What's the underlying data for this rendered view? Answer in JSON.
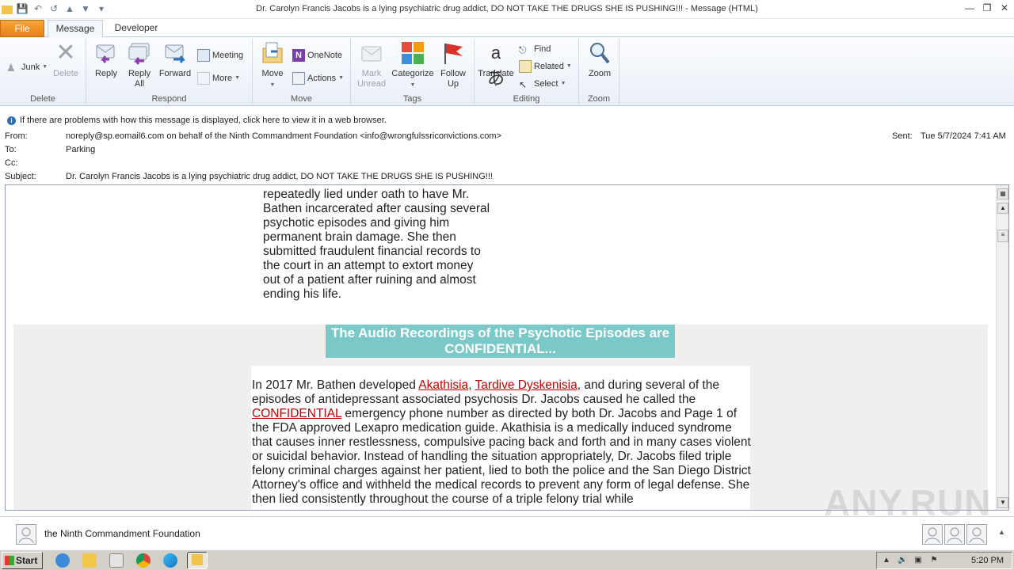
{
  "window": {
    "title": "Dr. Carolyn Francis Jacobs is a lying psychiatric drug addict, DO NOT TAKE THE DRUGS SHE IS PUSHING!!! - Message (HTML)"
  },
  "tabs": {
    "file": "File",
    "message": "Message",
    "developer": "Developer"
  },
  "ribbon": {
    "delete_group": {
      "label": "Delete",
      "junk": "Junk",
      "delete": "Delete"
    },
    "respond_group": {
      "label": "Respond",
      "reply": "Reply",
      "reply_all": "Reply All",
      "forward": "Forward",
      "meeting": "Meeting",
      "more": "More"
    },
    "move_group": {
      "label": "Move",
      "move": "Move",
      "onenote": "OneNote",
      "actions": "Actions"
    },
    "tags_group": {
      "label": "Tags",
      "mark_unread": "Mark Unread",
      "categorize": "Categorize",
      "follow_up": "Follow Up"
    },
    "editing_group": {
      "label": "Editing",
      "translate": "Translate",
      "find": "Find",
      "related": "Related",
      "select": "Select"
    },
    "zoom_group": {
      "label": "Zoom",
      "zoom": "Zoom"
    }
  },
  "infobar": {
    "text": "If there are problems with how this message is displayed, click here to view it in a web browser."
  },
  "headers": {
    "from_label": "From:",
    "from_value": "noreply@sp.eomail6.com on behalf of the Ninth Commandment Foundation <info@wrongfulssriconvictions.com>",
    "to_label": "To:",
    "to_value": "Parking",
    "cc_label": "Cc:",
    "cc_value": "",
    "subject_label": "Subject:",
    "subject_value": "Dr. Carolyn Francis Jacobs is a lying psychiatric drug addict, DO NOT TAKE THE DRUGS SHE IS PUSHING!!!",
    "sent_label": "Sent:",
    "sent_value": "Tue 5/7/2024 7:41 AM"
  },
  "message": {
    "para1": "repeatedly lied under oath to have Mr. Bathen incarcerated after causing several psychotic episodes and giving him permanent brain damage. She then submitted fraudulent financial records to the court in an attempt to extort money out of a patient after ruining and almost ending his life.",
    "banner": "The Audio Recordings of the Psychotic Episodes are CONFIDENTIAL...",
    "para2_a": "In 2017 Mr. Bathen developed ",
    "link_akathisia": "Akathisia",
    "para2_b": ", ",
    "link_tardive": "Tardive Dyskenisia",
    "para2_c": ", and during several of the episodes of antidepressant associated psychosis Dr. Jacobs caused he called the ",
    "link_confidential": "CONFIDENTIAL",
    "para2_d": " emergency phone number as directed by both Dr. Jacobs and Page 1 of the FDA approved Lexapro medication guide. Akathisia is a medically induced syndrome that causes inner restlessness, compulsive pacing back and forth and in many cases violent or suicidal behavior. Instead of handling the situation appropriately, Dr. Jacobs filed triple felony criminal charges against her patient, lied to both the police and the San Diego District Attorney's office and withheld the medical records to prevent any form of legal defense. She then lied consistently throughout the course of a triple felony trial while"
  },
  "people_pane": {
    "name": "the Ninth Commandment Foundation"
  },
  "taskbar": {
    "start": "Start",
    "clock": "5:20 PM"
  },
  "watermark": "ANY.RUN",
  "colors": {
    "file_tab": "#e8801a",
    "banner": "#7bc8c8",
    "link": "#c00000"
  }
}
